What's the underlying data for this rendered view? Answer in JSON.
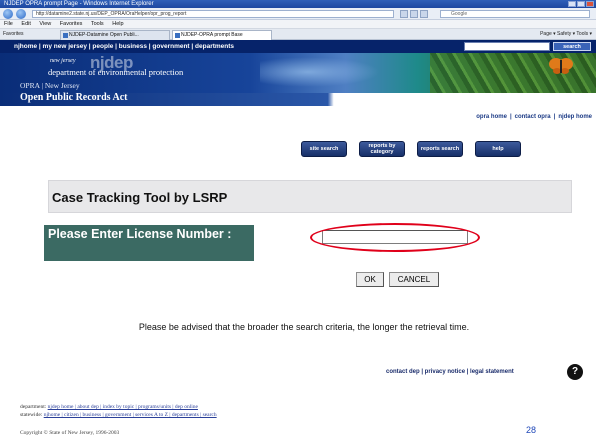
{
  "browser": {
    "title": "NJDEP OPRA prompt Page - Windows Internet Explorer",
    "url": "http://datamine2.state.nj.us/DEP_OPRA/OraHelper/opr_prog_report",
    "web_search_placeholder": "Google",
    "menu": [
      "File",
      "Edit",
      "View",
      "Favorites",
      "Tools",
      "Help"
    ],
    "favorites_label": "Favorites",
    "tabs": [
      "NJDEP-Datamine Open Publi...",
      "NJDEP-OPRA prompt Base"
    ],
    "command_bar": "Page ▾  Safety ▾  Tools ▾"
  },
  "nj_header": {
    "nav": "njhome | my new jersey | people | business | government | departments",
    "search_button": "search"
  },
  "dep_banner": {
    "new_jersey": "new jersey",
    "njdep": "njdep",
    "department": "department of environmental protection",
    "opra_line": "OPRA | New Jersey",
    "opra_title": "Open Public Records Act"
  },
  "opra_links": {
    "home": "opra home",
    "contact": "contact opra",
    "njdep_home": "njdep home",
    "separator": "|"
  },
  "nav_buttons": {
    "site_search": "site search",
    "reports_by_category": "reports by category",
    "reports_search": "reports search",
    "help": "help"
  },
  "case_tool": {
    "title": "Case Tracking Tool by LSRP",
    "license_label": "Please Enter License Number :",
    "license_value": ""
  },
  "buttons": {
    "ok": "OK",
    "cancel": "CANCEL"
  },
  "advisory": "Please be advised that the broader the search criteria, the longer the retrieval time.",
  "footer": {
    "links": "contact dep | privacy notice | legal statement",
    "help_icon": "?",
    "dept_line1_prefix": "department:",
    "dept_line1": "njdep home | about dep | index by topic | programs/units | dep online",
    "dept_line2_prefix": "statewide:",
    "dept_line2": "njhome | citizen | business | government | services A to Z | departments | search",
    "copyright": "Copyright © State of New Jersey, 1996-2003"
  },
  "slide_number": "28"
}
